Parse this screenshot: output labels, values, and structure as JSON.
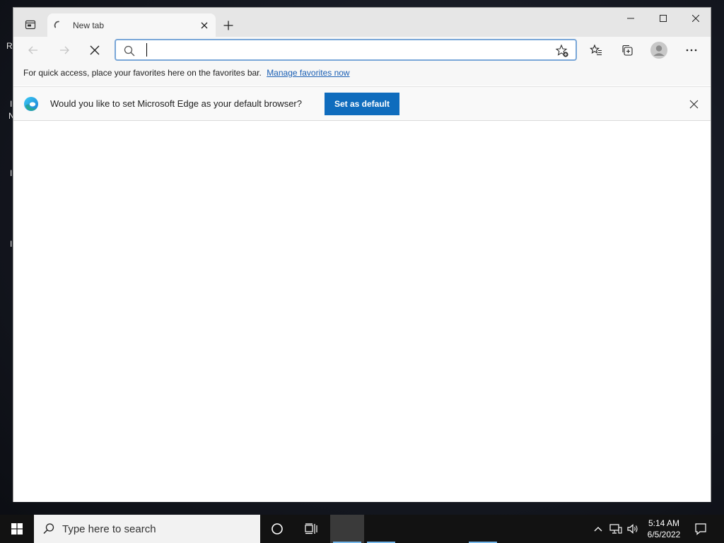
{
  "desktop": {
    "marks": [
      "R",
      "I",
      "N",
      "I",
      "I"
    ]
  },
  "browser": {
    "tab": {
      "title": "New tab"
    },
    "addressbar": {
      "value": "",
      "placeholder": ""
    },
    "favorites_bar": {
      "text": "For quick access, place your favorites here on the favorites bar.",
      "link": "Manage favorites now"
    },
    "infobar": {
      "message": "Would you like to set Microsoft Edge as your default browser?",
      "button": "Set as default"
    }
  },
  "taskbar": {
    "search_placeholder": "Type here to search",
    "time": "5:14 AM",
    "date": "6/5/2022"
  },
  "colors": {
    "accent": "#0f6cbd",
    "link": "#1a5fb4",
    "taskbar": "#121212"
  }
}
